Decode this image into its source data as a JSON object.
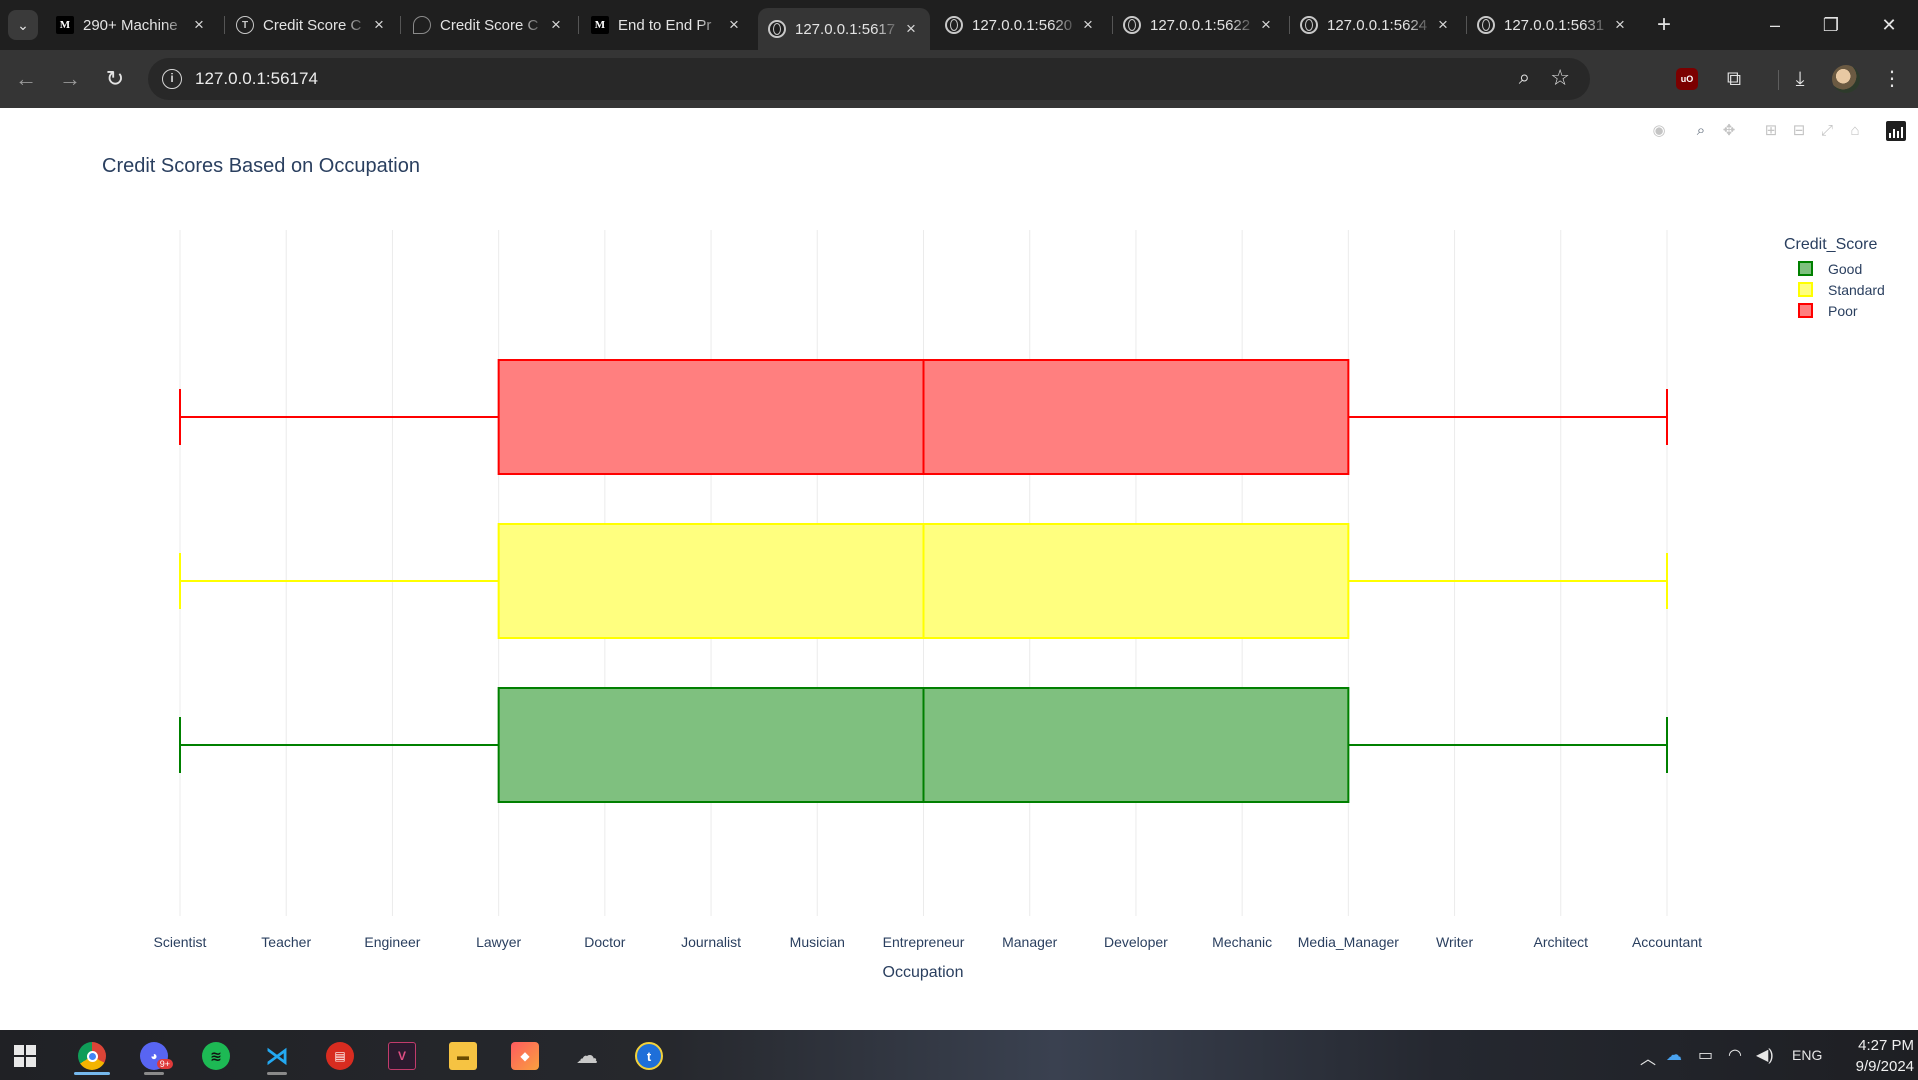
{
  "browser": {
    "tabs": [
      {
        "title": "290+ Machine",
        "icon": "medium-icon",
        "active": false
      },
      {
        "title": "Credit Score C",
        "icon": "circle-t-icon",
        "active": false
      },
      {
        "title": "Credit Score C",
        "icon": "chatgpt-icon",
        "active": false
      },
      {
        "title": "End to End Pr",
        "icon": "medium-icon",
        "active": false
      },
      {
        "title": "127.0.0.1:5617",
        "icon": "globe-icon",
        "active": true
      },
      {
        "title": "127.0.0.1:5620",
        "icon": "globe-icon",
        "active": false
      },
      {
        "title": "127.0.0.1:5622",
        "icon": "globe-icon",
        "active": false
      },
      {
        "title": "127.0.0.1:5624",
        "icon": "globe-icon",
        "active": false
      },
      {
        "title": "127.0.0.1:5631",
        "icon": "globe-icon",
        "active": false
      }
    ],
    "medium_glyph": "M",
    "circle_t_glyph": "T",
    "url": "127.0.0.1:56174",
    "ublock_glyph": "uO"
  },
  "chart_data": {
    "type": "box",
    "orientation": "horizontal",
    "title": "Credit Scores Based on Occupation",
    "xlabel": "Occupation",
    "categories": [
      "Scientist",
      "Teacher",
      "Engineer",
      "Lawyer",
      "Doctor",
      "Journalist",
      "Musician",
      "Entrepreneur",
      "Manager",
      "Developer",
      "Mechanic",
      "Media_Manager",
      "Writer",
      "Architect",
      "Accountant"
    ],
    "legend_title": "Credit_Score",
    "legend_position": "top-right",
    "grid": true,
    "series": [
      {
        "name": "Good",
        "color": "#008000",
        "fill": "#7fc07f",
        "min": "Scientist",
        "q1": "Lawyer",
        "median": "Entrepreneur",
        "q3": "Media_Manager",
        "max": "Accountant"
      },
      {
        "name": "Standard",
        "color": "#ffff00",
        "fill": "#ffff7f",
        "min": "Scientist",
        "q1": "Lawyer",
        "median": "Entrepreneur",
        "q3": "Media_Manager",
        "max": "Accountant"
      },
      {
        "name": "Poor",
        "color": "#ff0000",
        "fill": "#ff7f7f",
        "min": "Scientist",
        "q1": "Lawyer",
        "median": "Entrepreneur",
        "q3": "Media_Manager",
        "max": "Accountant"
      }
    ]
  },
  "taskbar": {
    "apps": [
      {
        "name": "chrome-icon",
        "state": "running"
      },
      {
        "name": "discord-icon",
        "state": "pinned",
        "badge": "9+"
      },
      {
        "name": "spotify-icon",
        "state": "none"
      },
      {
        "name": "vscode-icon",
        "state": "pinned"
      },
      {
        "name": "redis-icon",
        "state": "none"
      },
      {
        "name": "app-icon",
        "state": "none"
      },
      {
        "name": "file-explorer-icon",
        "state": "none"
      },
      {
        "name": "cube-app-icon",
        "state": "none"
      },
      {
        "name": "cloud-app-icon",
        "state": "none"
      },
      {
        "name": "tracker-icon",
        "state": "none"
      }
    ],
    "language": "ENG",
    "time": "4:27 PM",
    "date": "9/9/2024"
  }
}
